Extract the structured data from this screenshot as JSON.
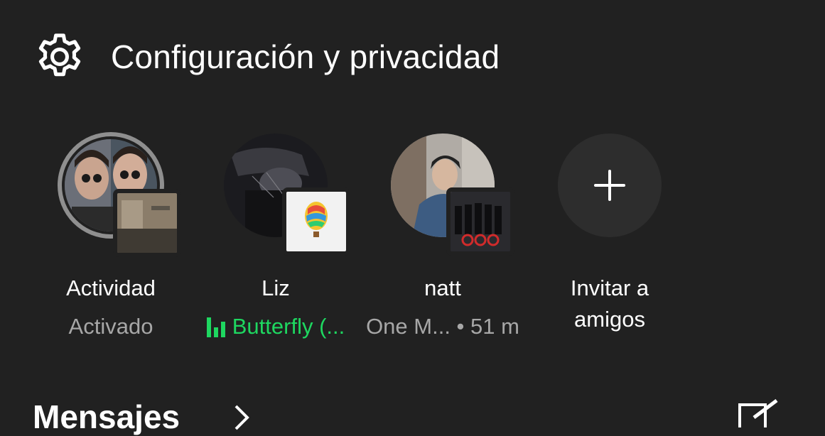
{
  "settings": {
    "title": "Configuración y privacidad",
    "icon": "gear-icon"
  },
  "friends": [
    {
      "name": "Actividad",
      "sub": "Activado",
      "playing": false
    },
    {
      "name": "Liz",
      "sub": "Butterfly (...",
      "playing": true
    },
    {
      "name": "natt",
      "sub": "One M... • 51 m",
      "playing": false
    },
    {
      "name": "Invitar a\namigos",
      "icon": "plus-icon"
    }
  ],
  "bottom": {
    "title": "Mensajes"
  },
  "colors": {
    "background": "#212121",
    "accent": "#1ed760",
    "muted": "#a7a7a7"
  }
}
